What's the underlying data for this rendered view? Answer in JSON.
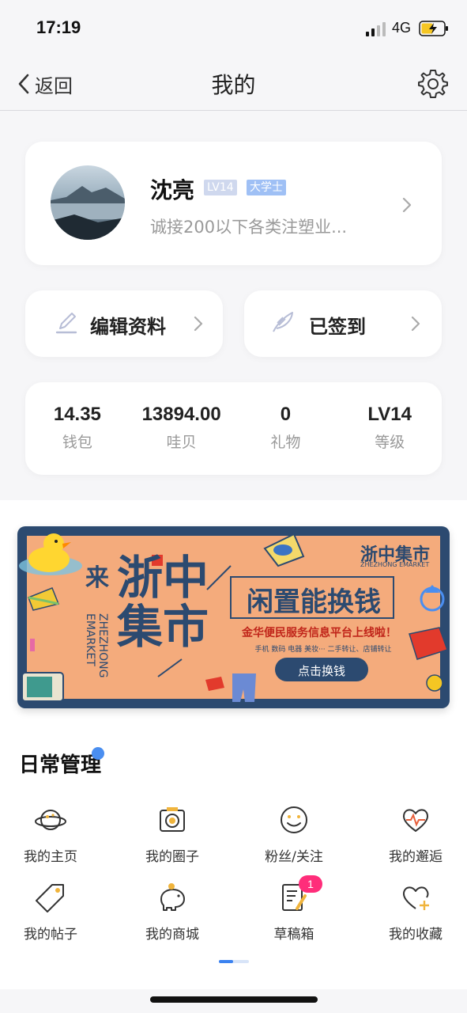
{
  "status_bar": {
    "time": "17:19",
    "network": "4G"
  },
  "nav": {
    "back_label": "返回",
    "title": "我的"
  },
  "profile": {
    "name": "沈亮",
    "level_badge": "LV14",
    "title_badge": "大学士",
    "bio": "诚接200以下各类注塑业..."
  },
  "actions": {
    "edit": "编辑资料",
    "sign_in": "已签到"
  },
  "stats": [
    {
      "value": "14.35",
      "label": "钱包"
    },
    {
      "value": "13894.00",
      "label": "哇贝"
    },
    {
      "value": "0",
      "label": "礼物"
    },
    {
      "value": "LV14",
      "label": "等级"
    }
  ],
  "banner": {
    "brand_lai": "来",
    "brand_big": "浙中集市",
    "brand_en": "ZHEZHONG EMARKET",
    "logo_cn": "浙中集市",
    "logo_en": "ZHEZHONG EMARKET",
    "headline": "闲置能换钱",
    "subline": "金华便民服务信息平台上线啦！",
    "categories": "手机  数码  电器  美妆···  二手转让、店铺转让",
    "cta": "点击换钱"
  },
  "section": {
    "title": "日常管理"
  },
  "grid": [
    {
      "label": "我的主页",
      "icon": "planet-icon"
    },
    {
      "label": "我的圈子",
      "icon": "camera-icon"
    },
    {
      "label": "粉丝/关注",
      "icon": "smiley-icon"
    },
    {
      "label": "我的邂逅",
      "icon": "heartbeat-icon"
    },
    {
      "label": "我的帖子",
      "icon": "tag-icon"
    },
    {
      "label": "我的商城",
      "icon": "piggy-bank-icon"
    },
    {
      "label": "草稿箱",
      "icon": "draft-icon",
      "badge": "1"
    },
    {
      "label": "我的收藏",
      "icon": "heart-plus-icon"
    }
  ],
  "colors": {
    "accent": "#3b82f0",
    "badge": "#ff2d7a",
    "banner_bg": "#f4ab7c",
    "banner_border": "#2c4a70"
  }
}
